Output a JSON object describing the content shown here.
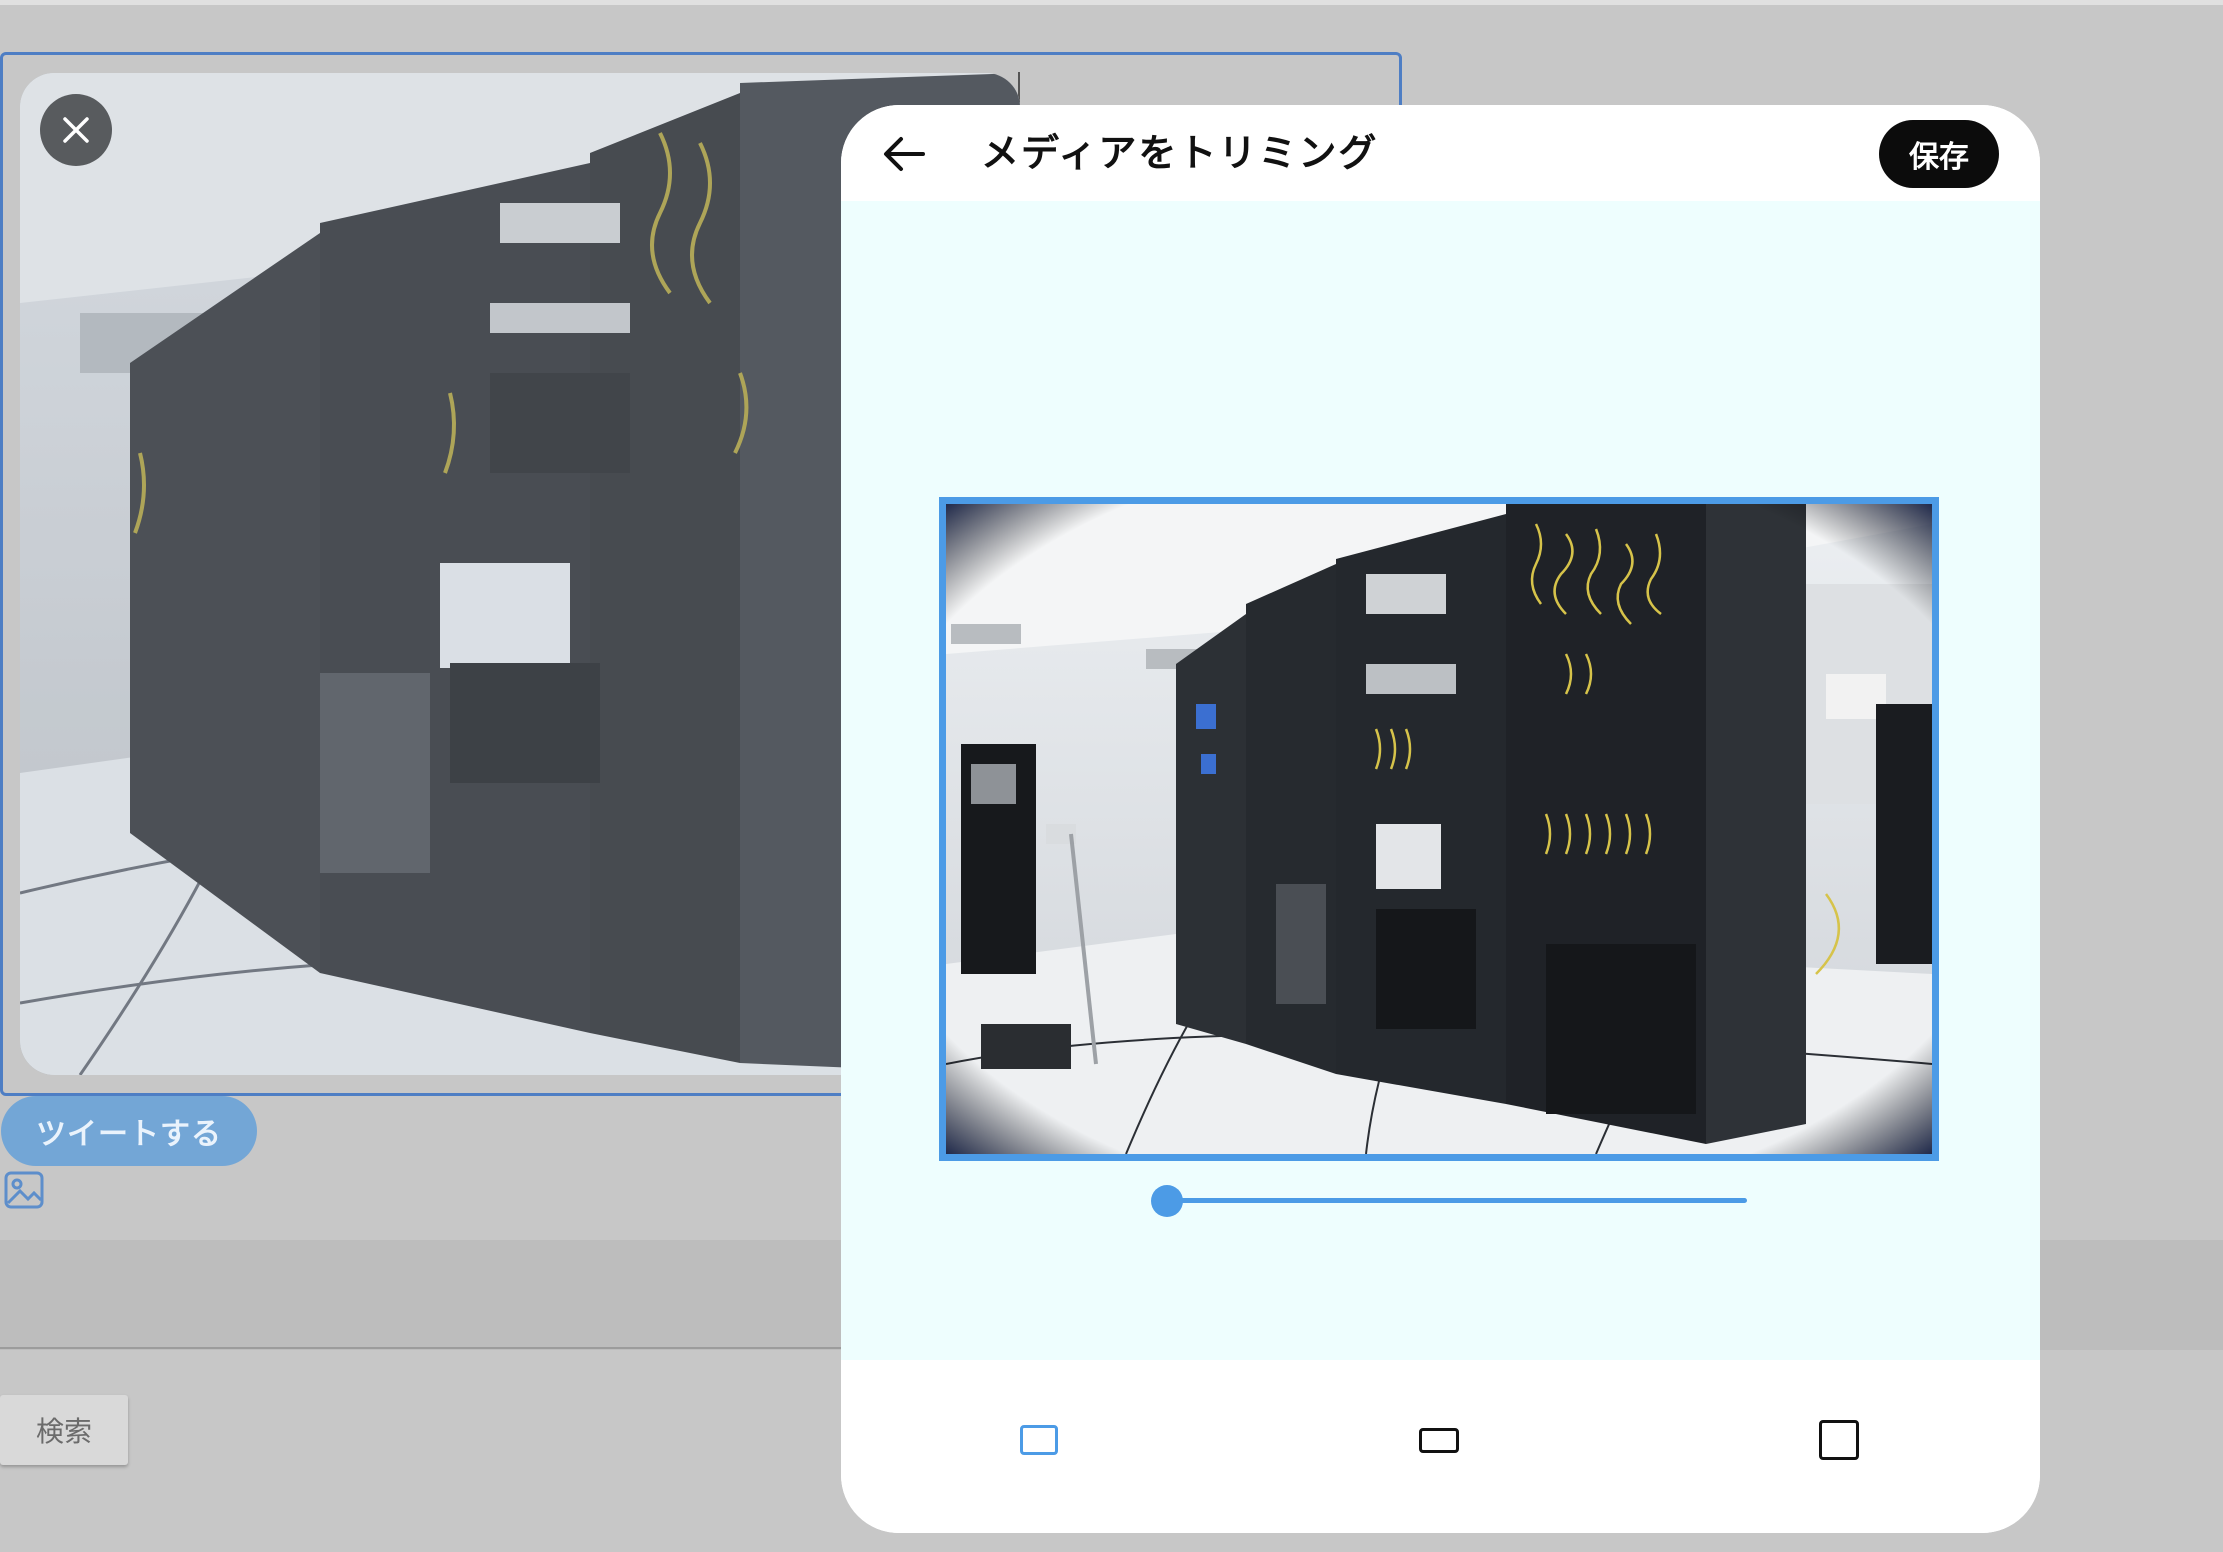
{
  "composer": {
    "tweet_button_label": "ツイートする",
    "search_button_label": "検索"
  },
  "modal": {
    "title": "メディアをトリミング",
    "save_label": "保存",
    "zoom_level": 0,
    "aspect_options": [
      {
        "name": "original",
        "selected": true
      },
      {
        "name": "wide",
        "selected": false
      },
      {
        "name": "square",
        "selected": false
      }
    ]
  },
  "icons": {
    "close": "close-icon",
    "back": "arrow-left-icon",
    "image": "image-icon",
    "aspect_original": "aspect-original-icon",
    "aspect_wide": "aspect-wide-icon",
    "aspect_square": "aspect-square-icon"
  },
  "colors": {
    "accent": "#4c9be6",
    "tweet_button": "#73a6d6",
    "save_button": "#0c0c0c",
    "crop_area_bg": "#eefefe",
    "overlay_bg": "#c7c7c7"
  }
}
